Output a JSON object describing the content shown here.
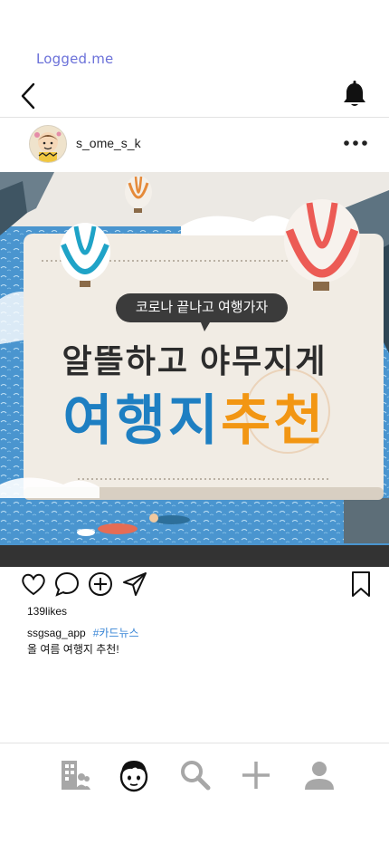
{
  "app": {
    "title": "Logged.me"
  },
  "post": {
    "username": "s_ome_s_k",
    "image": {
      "pill_text": "코로나 끝나고 여행가자",
      "headline_line1": "알뜰하고 야무지게",
      "headline_blue": "여행지",
      "headline_orange": "추천"
    },
    "likes": "139likes",
    "caption_user": "ssgsag_app",
    "caption_tag": "#카드뉴스",
    "caption_text": "올 여름 여행지 추천!"
  },
  "icons": {
    "back": "back-arrow-icon",
    "bell": "bell-icon",
    "more": "more-dots-icon",
    "like": "heart-icon",
    "comment": "comment-icon",
    "add": "plus-circle-icon",
    "share": "send-icon",
    "save": "bookmark-icon"
  },
  "tabs": [
    {
      "name": "feed",
      "icon": "building-icon"
    },
    {
      "name": "my-character",
      "icon": "character-face-icon",
      "active": true
    },
    {
      "name": "search",
      "icon": "search-icon"
    },
    {
      "name": "create",
      "icon": "plus-icon"
    },
    {
      "name": "profile",
      "icon": "person-icon"
    }
  ],
  "colors": {
    "accent": "#6b71d9",
    "tag": "#3a86d6",
    "inactive_icon": "#a7a7a7",
    "headline_blue": "#1e7fc2",
    "headline_orange": "#f29613"
  }
}
